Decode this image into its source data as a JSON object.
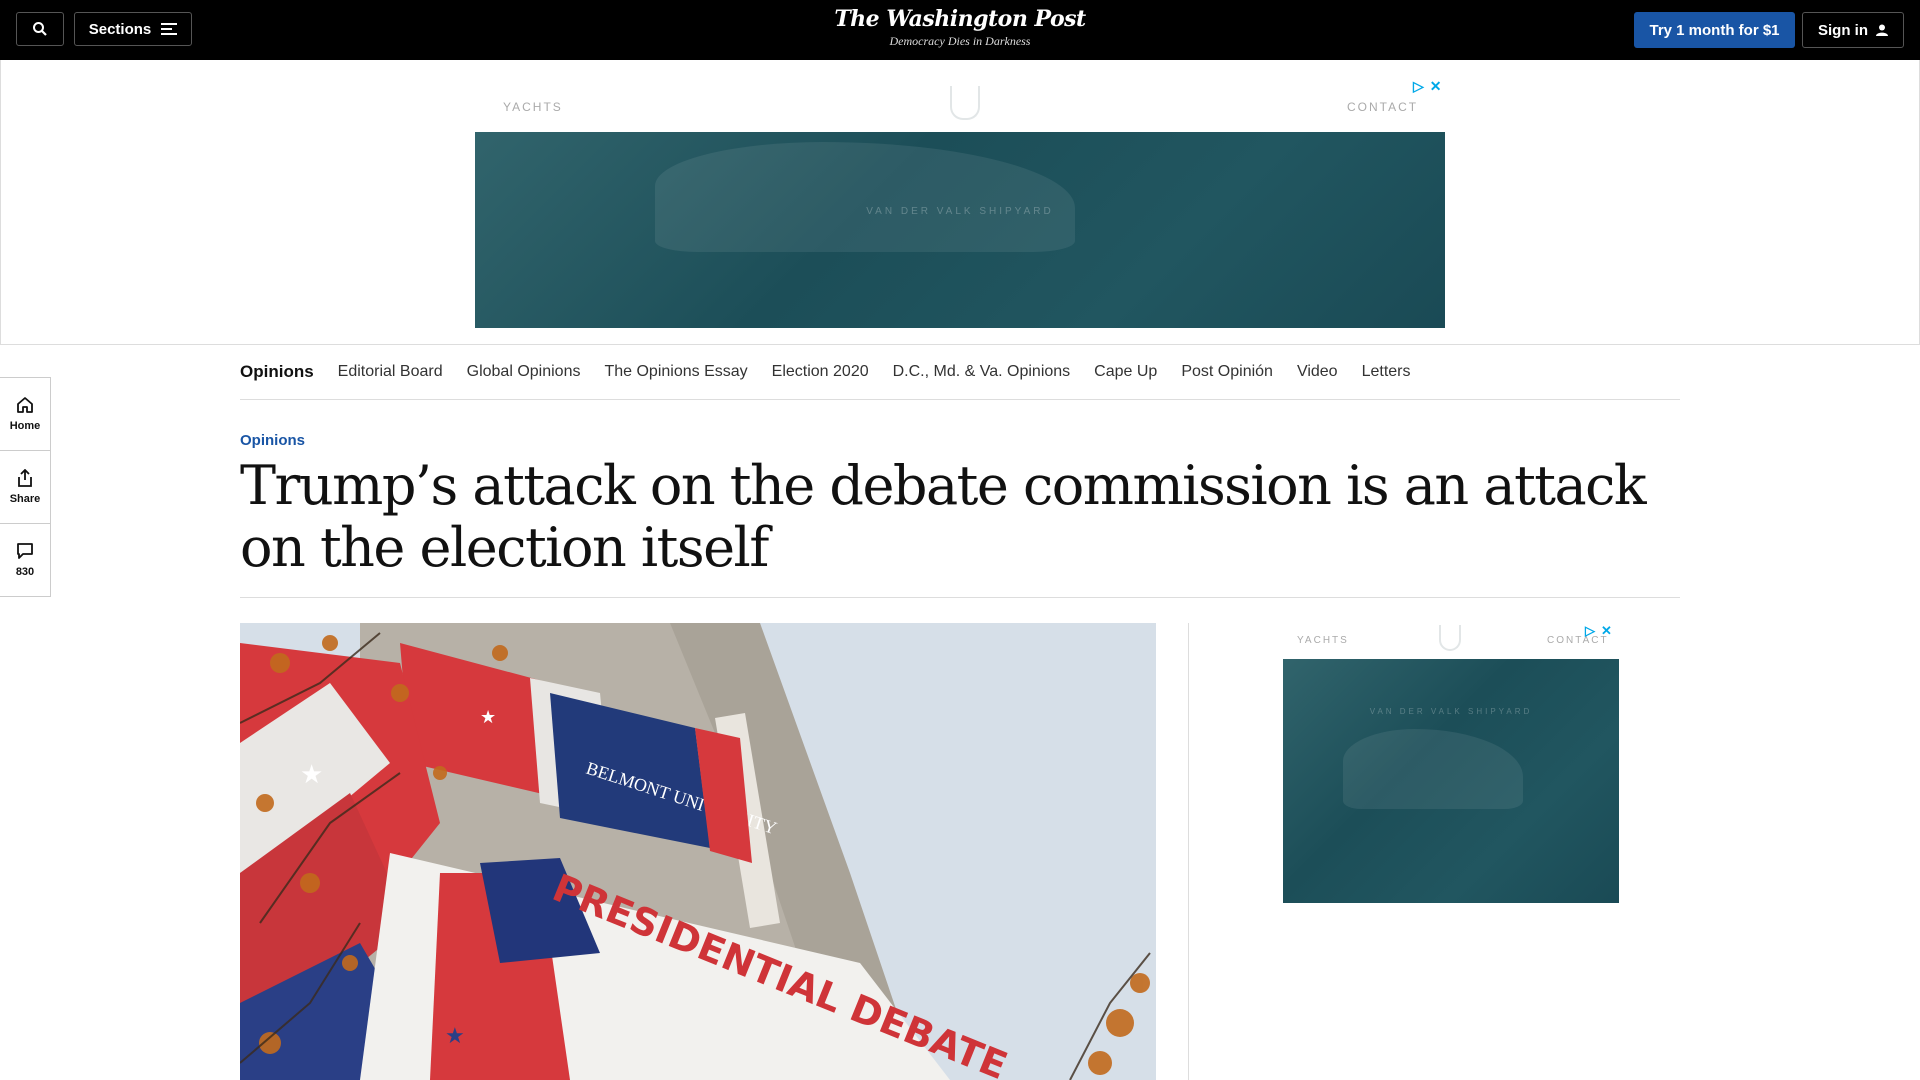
{
  "header": {
    "sections_label": "Sections",
    "brand_name": "The Washington Post",
    "brand_tagline": "Democracy Dies in Darkness",
    "subscribe_label": "Try 1 month for $1",
    "signin_label": "Sign in"
  },
  "ads": {
    "top": {
      "left_label": "YACHTS",
      "right_label": "CONTACT",
      "brand_text": "VAN DER VALK SHIPYARD"
    },
    "side": {
      "left_label": "YACHTS",
      "right_label": "CONTACT",
      "brand_text": "VAN DER VALK SHIPYARD"
    }
  },
  "section_nav": {
    "items": [
      {
        "label": "Opinions",
        "active": true
      },
      {
        "label": "Editorial Board"
      },
      {
        "label": "Global Opinions"
      },
      {
        "label": "The Opinions Essay"
      },
      {
        "label": "Election 2020"
      },
      {
        "label": "D.C., Md. & Va. Opinions"
      },
      {
        "label": "Cape Up"
      },
      {
        "label": "Post Opinión"
      },
      {
        "label": "Video"
      },
      {
        "label": "Letters"
      }
    ]
  },
  "rail": {
    "home_label": "Home",
    "share_label": "Share",
    "comments_count": "830"
  },
  "article": {
    "kicker": "Opinions",
    "headline": "Trump’s attack on the debate commission is an attack on the election itself",
    "hero_banner_text": "PRESIDENTIAL DEBATE",
    "hero_building_text": "BELMONT UNIVERSITY"
  },
  "colors": {
    "accent_blue": "#1955a5",
    "topbar_bg": "#000000",
    "ad_teal": "#1f5560"
  }
}
